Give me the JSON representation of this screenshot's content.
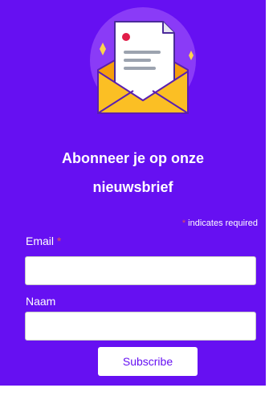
{
  "signup": {
    "title_line1": "Abonneer je op onze",
    "title_line2": "nieuwsbrief",
    "required_asterisk": "*",
    "required_note": "indicates required",
    "email_label": "Email",
    "email_asterisk": "*",
    "email_value": "",
    "name_label": "Naam",
    "name_value": "",
    "subscribe_label": "Subscribe"
  },
  "colors": {
    "background": "#6610f2",
    "required": "#e35050",
    "button_text": "#6610f2"
  },
  "icons": [
    "newsletter-envelope-icon",
    "sparkle-icon"
  ]
}
